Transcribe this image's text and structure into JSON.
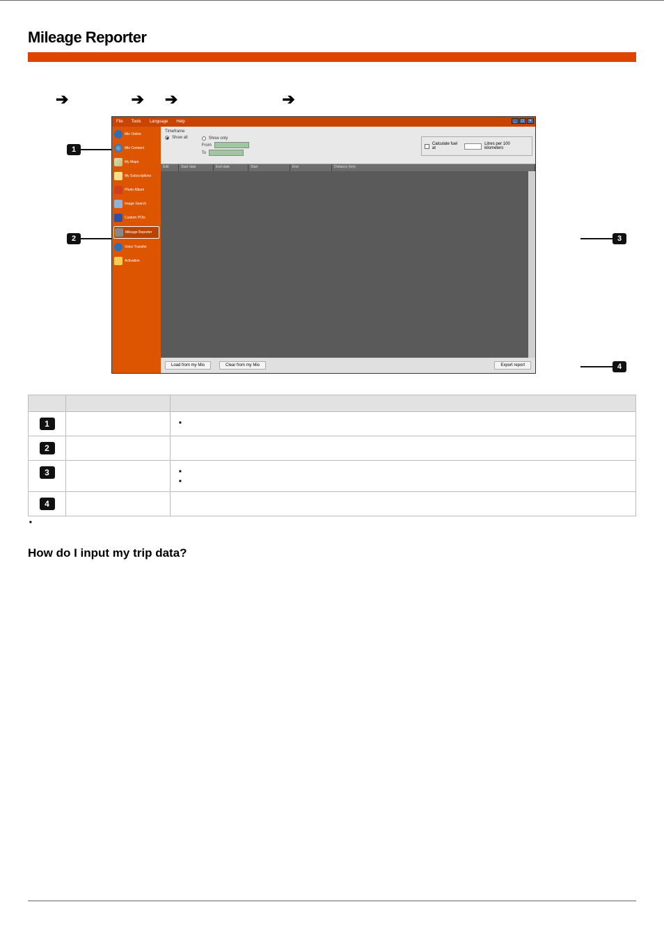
{
  "section_title": "Mileage Reporter",
  "subsection_title": "How do I input my trip data?",
  "screenshot": {
    "menubar": [
      "File",
      "Tools",
      "Language",
      "Help"
    ],
    "window_controls": [
      "_",
      "□",
      "×"
    ],
    "sidebar": [
      {
        "label": "Mio Online"
      },
      {
        "label": "Mio Connect"
      },
      {
        "label": "My Maps"
      },
      {
        "label": "My Subscriptions"
      },
      {
        "label": "Photo Album"
      },
      {
        "label": "Image Search"
      },
      {
        "label": "Custom POIs"
      },
      {
        "label": "Mileage Reporter"
      },
      {
        "label": "Voice Transfer"
      },
      {
        "label": "Activation"
      }
    ],
    "timeframe": {
      "group_label": "Timeframe",
      "show_all": "Show all",
      "show_only": "Show only",
      "from": "From",
      "to": "To"
    },
    "fuel": {
      "calc_label": "Calculate fuel at",
      "unit_label": "Litres per 100 kilometers"
    },
    "columns": [
      "Edit",
      "Start date",
      "End date",
      "Start",
      "End",
      "Distance (km)"
    ],
    "buttons": {
      "load": "Load from my Mio",
      "clear": "Clear from my Mio",
      "export": "Export report"
    }
  },
  "callouts": {
    "c1": "1",
    "c2": "2",
    "c3": "3",
    "c4": "4"
  },
  "legend": {
    "header": [
      "",
      "",
      ""
    ],
    "rows": [
      {
        "num": "1",
        "name": "",
        "desc_items": [
          ""
        ]
      },
      {
        "num": "2",
        "name": "",
        "desc_items": []
      },
      {
        "num": "3",
        "name": "",
        "desc_items": [
          "",
          ""
        ]
      },
      {
        "num": "4",
        "name": "",
        "desc_items": []
      }
    ]
  },
  "footnote": ""
}
